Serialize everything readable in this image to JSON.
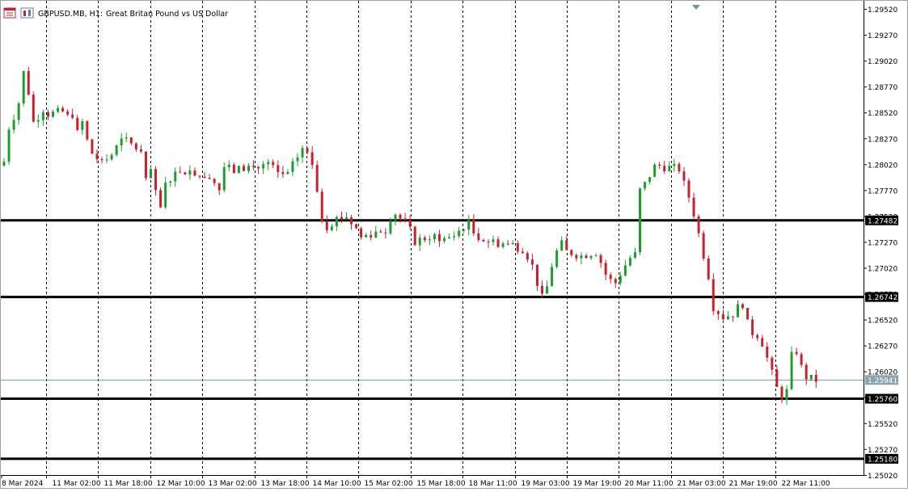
{
  "header": {
    "symbol_label": "GBPUSD.MB, H1:",
    "description": "Great Britan Pound vs US Dollar",
    "icons": [
      "chart-window-icon",
      "bars-icon"
    ]
  },
  "colors": {
    "background": "#ffffff",
    "bull": "#1c9e2c",
    "bear": "#c8202c",
    "hline": "#000000",
    "bid_line": "#7a9cab",
    "grid": "#000000",
    "axis": "#000000",
    "price_tag_bid_bg": "#8ba4b0"
  },
  "chart_data": {
    "type": "candlestick",
    "x_ticks": [
      "8 Mar 2024",
      "11 Mar 02:00",
      "11 Mar 18:00",
      "12 Mar 10:00",
      "13 Mar 02:00",
      "13 Mar 18:00",
      "14 Mar 10:00",
      "15 Mar 02:00",
      "15 Mar 18:00",
      "18 Mar 11:00",
      "19 Mar 03:00",
      "19 Mar 19:00",
      "20 Mar 11:00",
      "21 Mar 03:00",
      "21 Mar 19:00",
      "22 Mar 11:00"
    ],
    "y_ticks": [
      1.2952,
      1.2927,
      1.2902,
      1.2877,
      1.2852,
      1.2827,
      1.2802,
      1.2777,
      1.2752,
      1.2727,
      1.2702,
      1.2677,
      1.2652,
      1.2627,
      1.2602,
      1.2577,
      1.2552,
      1.2527,
      1.2502
    ],
    "ylim": [
      1.2493,
      1.2958
    ],
    "y_tick_labels": [
      "1.29520",
      "1.29270",
      "1.29020",
      "1.28770",
      "1.28520",
      "1.28270",
      "1.28020",
      "1.27770",
      "1.27520",
      "1.27270",
      "1.27020",
      "1.26770",
      "1.26520",
      "1.26270",
      "1.26020",
      "1.25770",
      "1.25520",
      "1.25270",
      "1.25020"
    ],
    "horizontal_lines": [
      {
        "value": 1.27482,
        "label": "1.27482"
      },
      {
        "value": 1.26742,
        "label": "1.26742"
      },
      {
        "value": 1.2576,
        "label": "1.25760"
      },
      {
        "value": 1.2518,
        "label": "1.25180"
      }
    ],
    "bid": {
      "value": 1.25941,
      "label": "1.25941"
    },
    "price_path": [
      [
        0,
        1.2805
      ],
      [
        1,
        1.2838
      ],
      [
        2,
        1.2849
      ],
      [
        3,
        1.2862
      ],
      [
        4,
        1.2891
      ],
      [
        5,
        1.2872
      ],
      [
        6,
        1.2843
      ],
      [
        7,
        1.2849
      ],
      [
        8,
        1.2856
      ],
      [
        9,
        1.2851
      ],
      [
        12,
        1.2853
      ],
      [
        13,
        1.2848
      ],
      [
        14,
        1.2851
      ],
      [
        15,
        1.2832
      ],
      [
        16,
        1.2843
      ],
      [
        17,
        1.2825
      ],
      [
        18,
        1.2813
      ],
      [
        19,
        1.2808
      ],
      [
        20,
        1.2803
      ],
      [
        22,
        1.2812
      ],
      [
        24,
        1.2825
      ],
      [
        26,
        1.2822
      ],
      [
        27,
        1.2818
      ],
      [
        28,
        1.2813
      ],
      [
        29,
        1.2785
      ],
      [
        30,
        1.2797
      ],
      [
        31,
        1.2773
      ],
      [
        32,
        1.276
      ],
      [
        33,
        1.2782
      ],
      [
        34,
        1.279
      ],
      [
        36,
        1.2797
      ],
      [
        38,
        1.2796
      ],
      [
        40,
        1.2793
      ],
      [
        42,
        1.2792
      ],
      [
        44,
        1.2778
      ],
      [
        45,
        1.28
      ],
      [
        47,
        1.2796
      ],
      [
        50,
        1.28
      ],
      [
        52,
        1.2799
      ],
      [
        54,
        1.2803
      ],
      [
        56,
        1.2793
      ],
      [
        58,
        1.2792
      ],
      [
        60,
        1.281
      ],
      [
        61,
        1.2818
      ],
      [
        62,
        1.2812
      ],
      [
        63,
        1.2802
      ],
      [
        64,
        1.2779
      ],
      [
        65,
        1.275
      ],
      [
        66,
        1.2743
      ],
      [
        68,
        1.275
      ],
      [
        70,
        1.2752
      ],
      [
        72,
        1.274
      ],
      [
        73,
        1.2732
      ],
      [
        74,
        1.2734
      ],
      [
        76,
        1.2737
      ],
      [
        78,
        1.2739
      ],
      [
        79,
        1.2752
      ],
      [
        80,
        1.2755
      ],
      [
        82,
        1.2745
      ],
      [
        83,
        1.2738
      ],
      [
        84,
        1.2728
      ],
      [
        86,
        1.2731
      ],
      [
        88,
        1.2733
      ],
      [
        90,
        1.273
      ],
      [
        92,
        1.2733
      ],
      [
        94,
        1.2743
      ],
      [
        95,
        1.2745
      ],
      [
        96,
        1.2736
      ],
      [
        98,
        1.273
      ],
      [
        100,
        1.2727
      ],
      [
        102,
        1.2726
      ],
      [
        104,
        1.2724
      ],
      [
        106,
        1.2721
      ],
      [
        107,
        1.2714
      ],
      [
        108,
        1.2704
      ],
      [
        109,
        1.2688
      ],
      [
        110,
        1.2673
      ],
      [
        111,
        1.2684
      ],
      [
        112,
        1.2705
      ],
      [
        113,
        1.2718
      ],
      [
        114,
        1.2725
      ],
      [
        115,
        1.2718
      ],
      [
        116,
        1.2717
      ],
      [
        118,
        1.2714
      ],
      [
        120,
        1.2717
      ],
      [
        121,
        1.2718
      ],
      [
        122,
        1.2708
      ],
      [
        123,
        1.2696
      ],
      [
        124,
        1.269
      ],
      [
        125,
        1.2688
      ],
      [
        126,
        1.2697
      ],
      [
        127,
        1.2705
      ],
      [
        128,
        1.2712
      ],
      [
        129,
        1.2715
      ],
      [
        130,
        1.2777
      ],
      [
        131,
        1.2783
      ],
      [
        132,
        1.2792
      ],
      [
        133,
        1.28
      ],
      [
        134,
        1.2801
      ],
      [
        135,
        1.28
      ],
      [
        136,
        1.2799
      ],
      [
        138,
        1.2798
      ],
      [
        139,
        1.2783
      ],
      [
        140,
        1.2771
      ],
      [
        141,
        1.2755
      ],
      [
        142,
        1.2735
      ],
      [
        143,
        1.2715
      ],
      [
        144,
        1.2695
      ],
      [
        145,
        1.2665
      ],
      [
        146,
        1.266
      ],
      [
        147,
        1.2655
      ],
      [
        149,
        1.2658
      ],
      [
        150,
        1.2664
      ],
      [
        151,
        1.2668
      ],
      [
        152,
        1.2648
      ],
      [
        153,
        1.264
      ],
      [
        154,
        1.2638
      ],
      [
        155,
        1.263
      ],
      [
        156,
        1.2615
      ],
      [
        157,
        1.26
      ],
      [
        158,
        1.2586
      ],
      [
        159,
        1.2578
      ],
      [
        160,
        1.2583
      ],
      [
        161,
        1.2617
      ],
      [
        162,
        1.2622
      ],
      [
        163,
        1.2606
      ],
      [
        164,
        1.2597
      ],
      [
        165,
        1.2595
      ],
      [
        166,
        1.2594
      ]
    ]
  }
}
